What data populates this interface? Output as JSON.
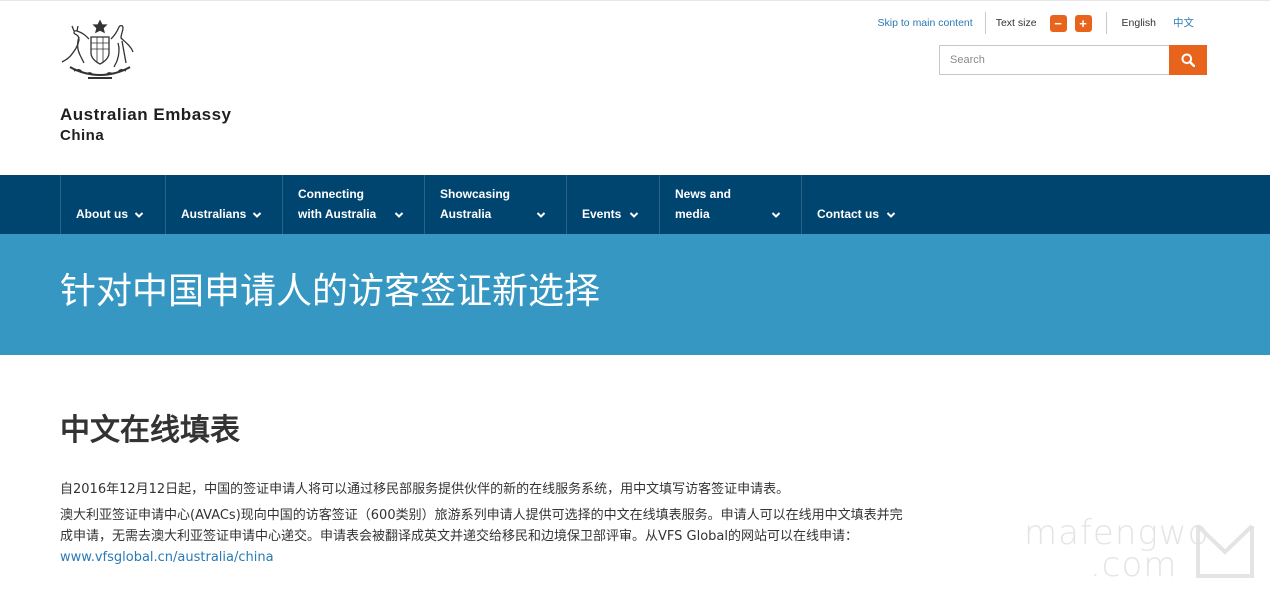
{
  "header": {
    "site_name_line1": "Australian Embassy",
    "site_name_line2": "China",
    "skip_link": "Skip to main content",
    "text_size_label": "Text size",
    "text_size_decrease": "−",
    "text_size_increase": "+",
    "lang_english": "English",
    "lang_chinese": "中文",
    "search_placeholder": "Search",
    "crest_icon": "coat-of-arms-icon",
    "search_icon": "search-icon"
  },
  "nav": {
    "items": [
      {
        "label": "About us"
      },
      {
        "label": "Australians"
      },
      {
        "label": "Connecting\nwith Australia"
      },
      {
        "label": "Showcasing\nAustralia"
      },
      {
        "label": "Events"
      },
      {
        "label": "News and\nmedia"
      },
      {
        "label": "Contact us"
      }
    ]
  },
  "banner": {
    "title": "针对中国申请人的访客签证新选择"
  },
  "main": {
    "heading": "中文在线填表",
    "para1": "自2016年12月12日起，中国的签证申请人将可以通过移民部服务提供伙伴的新的在线服务系统，用中文填写访客签证申请表。",
    "para2": "澳大利亚签证申请中心(AVACs)现向中国的访客签证（600类别）旅游系列申请人提供可选择的中文在线填表服务。申请人可以在线用中文填表并完成申请，无需去澳大利亚签证申请中心递交。申请表会被翻译成英文并递交给移民和边境保卫部评审。从VFS Global的网站可以在线申请：",
    "para2_link": "www.vfsglobal.cn/australia/china"
  },
  "watermark": {
    "line1": "mafengwo",
    "line2": ".com"
  },
  "colors": {
    "nav_bg": "#004470",
    "banner_bg": "#3597c2",
    "accent_orange": "#e8641c",
    "link_blue": "#2a7ab4"
  }
}
